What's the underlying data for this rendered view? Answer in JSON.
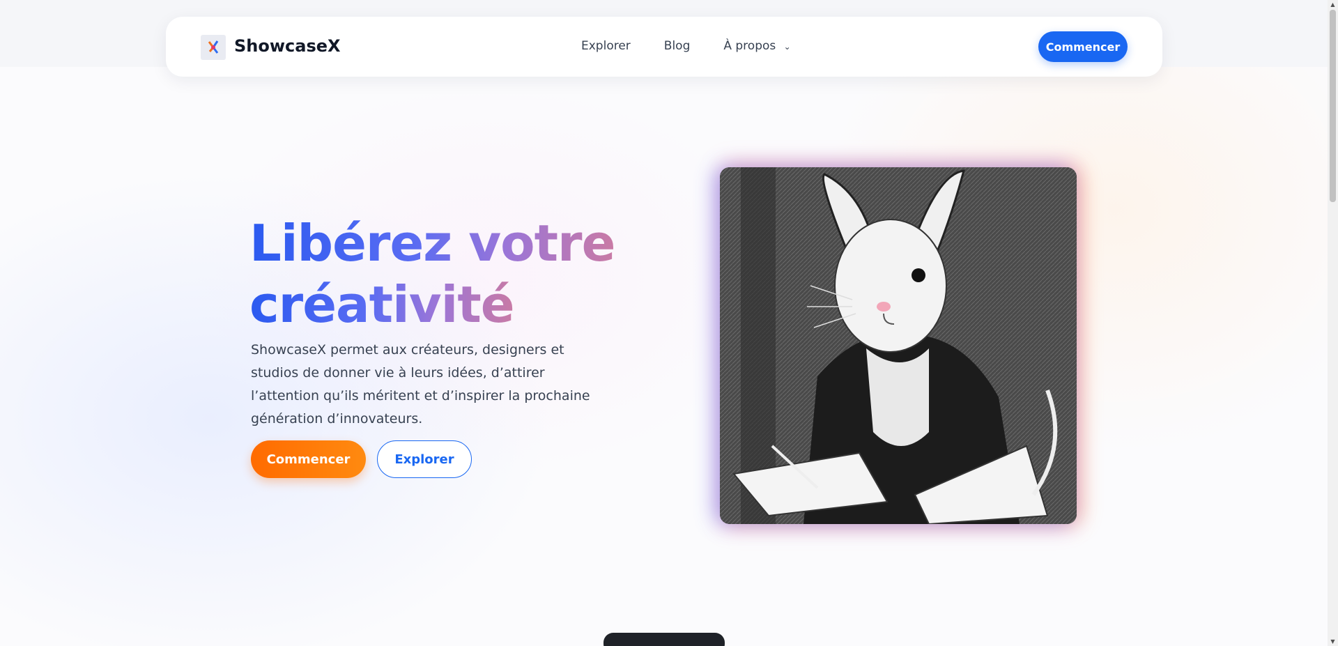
{
  "app": {
    "brand": "ShowcaseX"
  },
  "nav": {
    "links": [
      "Explorer",
      "Blog",
      "À propos"
    ],
    "cta": "Commencer"
  },
  "hero": {
    "title_line1": "Libérez votre",
    "title_line2": "créativité",
    "text": "ShowcaseX permet aux créateurs, designers et studios de donner vie à leurs idées, d’attirer l’attention qu’ils méritent et d’inspirer la prochaine génération d’innovateurs.",
    "primary_button": "Commencer",
    "secondary_button": "Explorer"
  },
  "colors": {
    "accent": "#1967f2",
    "primary_button": "#ff6b00"
  },
  "icons": [
    "logo-icon",
    "chevron-down-icon"
  ]
}
